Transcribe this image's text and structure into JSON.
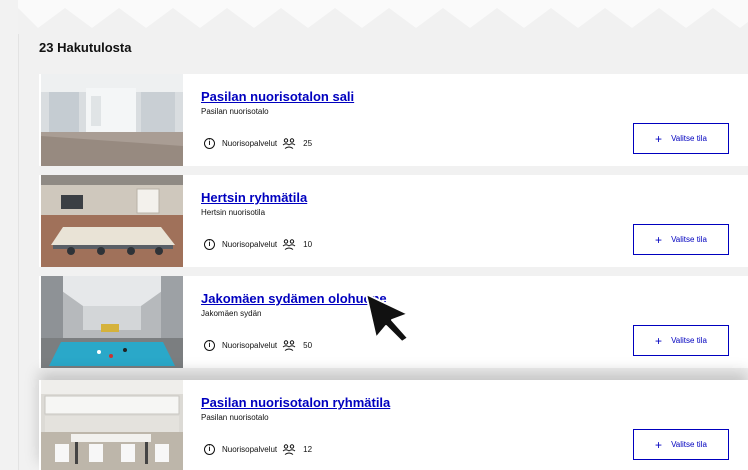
{
  "results": {
    "count_label": "23 Hakutulosta",
    "items": [
      {
        "title": "Pasilan nuorisotalon sali",
        "subtitle": "Pasilan nuorisotalo",
        "unit": "Nuorisopalvelut",
        "capacity": "25",
        "button_label": "Valitse tila"
      },
      {
        "title": "Hertsin ryhmätila",
        "subtitle": "Hertsin nuorisotila",
        "unit": "Nuorisopalvelut",
        "capacity": "10",
        "button_label": "Valitse tila"
      },
      {
        "title": "Jakomäen sydämen olohuone",
        "subtitle": "Jakomäen sydän",
        "unit": "Nuorisopalvelut",
        "capacity": "50",
        "button_label": "Valitse tila"
      },
      {
        "title": "Pasilan nuorisotalon ryhmätila",
        "subtitle": "Pasilan nuorisotalo",
        "unit": "Nuorisopalvelut",
        "capacity": "12",
        "button_label": "Valitse tila"
      }
    ]
  },
  "icons": {
    "info": "info-icon",
    "people": "people-icon",
    "plus": "plus-icon",
    "cursor": "mouse-cursor-icon"
  },
  "colors": {
    "link": "#0000bf",
    "background": "#f1f1f1",
    "card": "#ffffff"
  }
}
